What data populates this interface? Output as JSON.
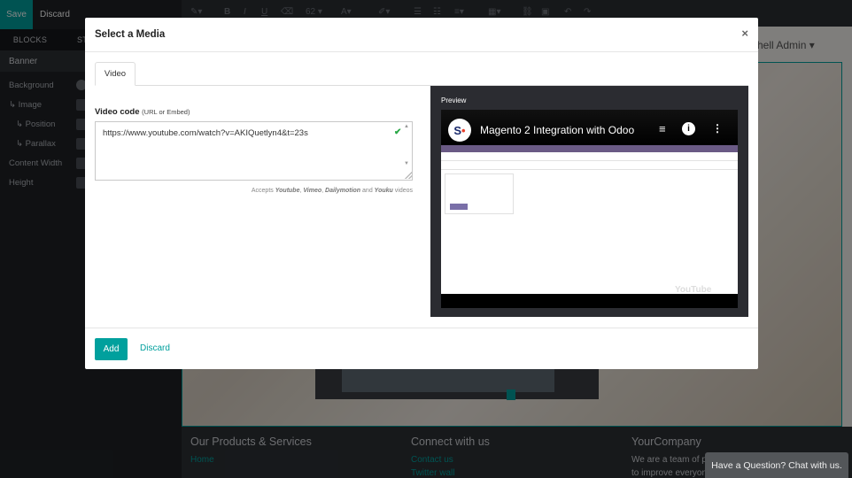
{
  "editor": {
    "save_label": "Save",
    "discard_label": "Discard",
    "tabs": [
      "BLOCKS",
      "STYLE"
    ],
    "section_title": "Banner",
    "options": [
      {
        "label": "Background"
      },
      {
        "label": "Image"
      },
      {
        "label": "Position"
      },
      {
        "label": "Parallax"
      },
      {
        "label": "Content Width"
      },
      {
        "label": "Height"
      }
    ],
    "toolbar_font_size": "62",
    "user_name": "hell Admin"
  },
  "footer": {
    "col1_title": "Our Products & Services",
    "col1_link1": "Home",
    "col2_title": "Connect with us",
    "col2_link1": "Contact us",
    "col2_link2": "Twitter wall",
    "col3_title": "YourCompany",
    "col3_text1": "We are a team of p",
    "col3_text2": "to improve everyon",
    "chat_label": "Have a Question? Chat with us."
  },
  "modal": {
    "title": "Select a Media",
    "close_glyph": "×",
    "tab_video": "Video",
    "video_code_label": "Video code",
    "video_code_hint": "(URL or Embed)",
    "video_code_value": "https://www.youtube.com/watch?v=AKIQuetlyn4&t=23s",
    "accepts_prefix": "Accepts",
    "accepts_youtube": "Youtube",
    "accepts_vimeo": "Vimeo",
    "accepts_dailymotion": "Dailymotion",
    "accepts_and": "and",
    "accepts_youku": "Youku",
    "accepts_suffix": "videos",
    "preview_label": "Preview",
    "video_title": "Magento 2 Integration with Odoo",
    "video_brand": "YouTube",
    "add_label": "Add",
    "discard_label": "Discard"
  },
  "colors": {
    "accent": "#00a09d",
    "check": "#28a745",
    "preview_bg": "#2b2c31"
  }
}
